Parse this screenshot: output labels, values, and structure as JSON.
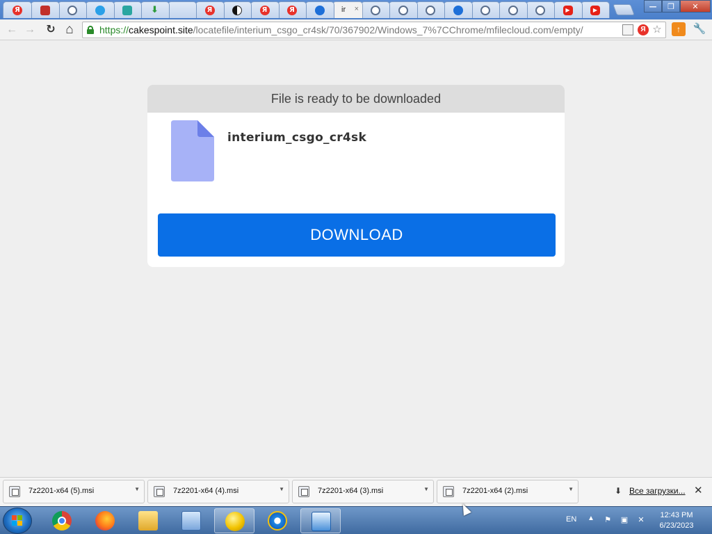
{
  "browser": {
    "tabs": [
      {
        "icon": "yandex-icon",
        "glyph": "Я",
        "cls": "ya"
      },
      {
        "icon": "shield-icon",
        "glyph": "",
        "cls": "shield"
      },
      {
        "icon": "globe-icon",
        "glyph": "",
        "cls": "globe"
      },
      {
        "icon": "cloud-icon",
        "glyph": "",
        "cls": "cloud"
      },
      {
        "icon": "share-icon",
        "glyph": "",
        "cls": "share"
      },
      {
        "icon": "download-icon",
        "glyph": "⬇",
        "cls": "dl"
      },
      {
        "icon": "blank-icon",
        "glyph": "",
        "cls": "blank"
      },
      {
        "icon": "yandex-icon",
        "glyph": "Я",
        "cls": "ya"
      },
      {
        "icon": "half-circle-icon",
        "glyph": "",
        "cls": "half"
      },
      {
        "icon": "yandex-icon",
        "glyph": "Я",
        "cls": "ya"
      },
      {
        "icon": "yandex-icon",
        "glyph": "Я",
        "cls": "ya"
      },
      {
        "icon": "fish-icon",
        "glyph": "",
        "cls": "fish"
      },
      {
        "active": true,
        "label": "ir",
        "close": "×"
      },
      {
        "icon": "globe-icon",
        "glyph": "",
        "cls": "globe"
      },
      {
        "icon": "globe-icon",
        "glyph": "",
        "cls": "globe"
      },
      {
        "icon": "globe-icon",
        "glyph": "",
        "cls": "globe"
      },
      {
        "icon": "fish-icon",
        "glyph": "",
        "cls": "fish"
      },
      {
        "icon": "globe-icon",
        "glyph": "",
        "cls": "globe"
      },
      {
        "icon": "globe-icon",
        "glyph": "",
        "cls": "globe"
      },
      {
        "icon": "globe-icon",
        "glyph": "",
        "cls": "globe"
      },
      {
        "icon": "youtube-icon",
        "glyph": "▶",
        "cls": "yt"
      },
      {
        "icon": "youtube-icon",
        "glyph": "▶",
        "cls": "yt"
      }
    ],
    "url": {
      "scheme": "https://",
      "host": "cakespoint.site",
      "path": "/locatefile/interium_csgo_cr4sk/70/367902/Windows_7%7CChrome/mfilecloud.com/empty/"
    },
    "window_controls": {
      "minimize": "—",
      "maximize": "❐",
      "close": "✕"
    },
    "toolbar_icons": {
      "back": "←",
      "forward": "→",
      "reload": "↻",
      "home": "⌂",
      "star": "☆",
      "ext": "↑",
      "wrench": "🔧",
      "yandex": "Я"
    }
  },
  "page": {
    "header": "File is ready to be downloaded",
    "file_name": "interium_csgo_cr4sk",
    "download_label": "DOWNLOAD",
    "colors": {
      "button": "#0a6fe6",
      "file_icon": "#a7b2f7"
    }
  },
  "downloads": {
    "items": [
      {
        "name": "7z2201-x64 (5).msi"
      },
      {
        "name": "7z2201-x64 (4).msi"
      },
      {
        "name": "7z2201-x64 (3).msi"
      },
      {
        "name": "7z2201-x64 (2).msi"
      }
    ],
    "show_all": "Все загрузки...",
    "close": "✕"
  },
  "taskbar": {
    "apps": [
      "chrome",
      "firefox",
      "explorer",
      "control-panel",
      "ball-app",
      "internet-explorer",
      "file-app"
    ],
    "language": "EN",
    "time": "12:43 PM",
    "date": "6/23/2023"
  }
}
